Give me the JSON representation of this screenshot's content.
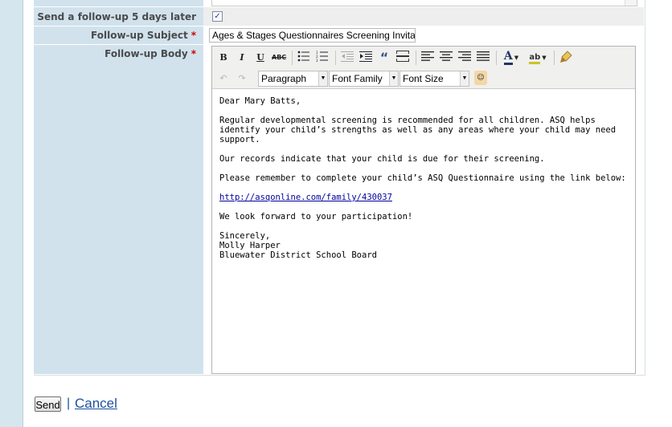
{
  "form": {
    "followup_checkbox_label": "Send a follow-up 5 days later",
    "followup_checked": true,
    "subject_label": "Follow-up Subject",
    "subject_value": "Ages & Stages Questionnaires Screening Invitation",
    "body_label": "Follow-up Body",
    "required_mark": "*"
  },
  "editor": {
    "toolbar": {
      "bold": "B",
      "italic": "I",
      "underline": "U",
      "strike": "ABC",
      "quote": "“",
      "font_color": "A",
      "highlight": "ab",
      "format": "Paragraph",
      "font_family": "Font Family",
      "font_size": "Font Size",
      "icons": [
        "bullet-list-icon",
        "numbered-list-icon",
        "outdent-icon",
        "indent-icon",
        "blockquote-icon",
        "horizontal-rule-icon",
        "align-left-icon",
        "align-center-icon",
        "align-right-icon",
        "justify-icon",
        "font-color-icon",
        "highlight-color-icon",
        "cleanup-icon",
        "undo-icon",
        "redo-icon",
        "emoticon-icon"
      ]
    },
    "body": {
      "greeting": "Dear Mary Batts,",
      "p1": "Regular developmental screening is recommended for all children. ASQ helps identify your child’s strengths as well as any areas where your child may need support.",
      "p2": "Our records indicate that your child is due for their screening.",
      "p3": "Please remember to complete your child’s ASQ Questionnaire using the link below:",
      "link": "http://asqonline.com/family/430037",
      "p4": "We look forward to your participation!",
      "closing": "Sincerely,",
      "sender_name": "Molly Harper",
      "sender_org": "Bluewater District School Board"
    }
  },
  "actions": {
    "send": "Send",
    "separator": "|",
    "cancel": "Cancel"
  },
  "colors": {
    "label_bg": "#d1e2ed",
    "link": "#1e4f9c",
    "required": "#cc0000"
  }
}
